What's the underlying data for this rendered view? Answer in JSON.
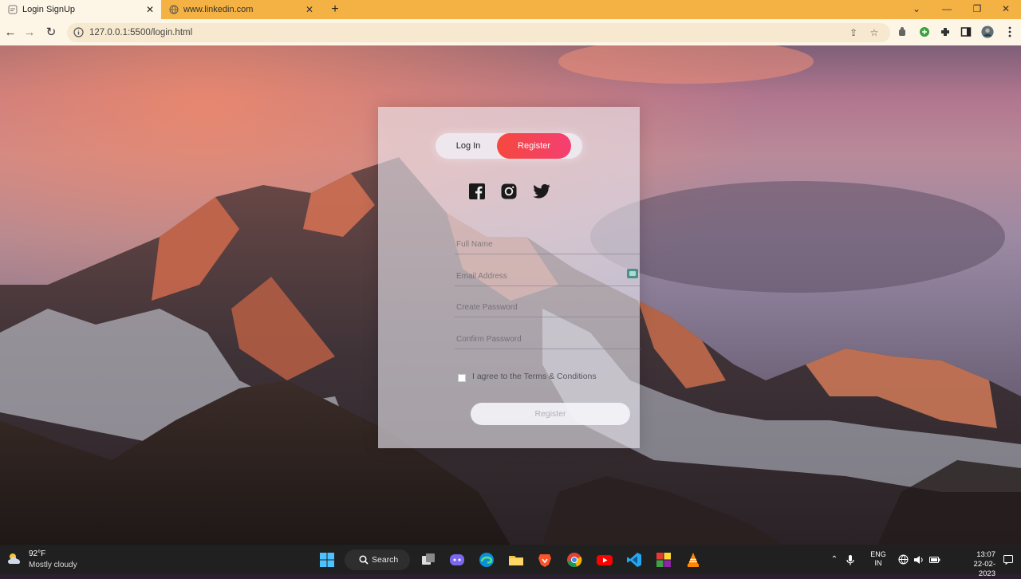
{
  "browser": {
    "tabs": [
      {
        "title": "Login SignUp",
        "active": true
      },
      {
        "title": "www.linkedin.com",
        "active": false
      }
    ],
    "url": "127.0.0.1:5500/login.html",
    "accent": "#f4b244",
    "window_controls": [
      "minimize",
      "restore",
      "close"
    ]
  },
  "form": {
    "toggle": {
      "login_label": "Log In",
      "register_label": "Register",
      "selected": "Register"
    },
    "social_icons": [
      "facebook-icon",
      "instagram-icon",
      "twitter-icon"
    ],
    "fields": {
      "full_name_placeholder": "Full Name",
      "email_placeholder": "Email Address",
      "password_placeholder": "Create Password",
      "confirm_placeholder": "Confirm Password"
    },
    "terms_label": "I agree to the Terms & Conditions",
    "terms_checked": false,
    "submit_label": "Register",
    "register_gradient": [
      "#f5483e",
      "#f43f72"
    ]
  },
  "taskbar": {
    "weather": {
      "temp": "92°F",
      "condition": "Mostly cloudy"
    },
    "search_label": "Search",
    "language": {
      "line1": "ENG",
      "line2": "IN"
    },
    "time": "13:07",
    "date": "22-02-2023"
  }
}
